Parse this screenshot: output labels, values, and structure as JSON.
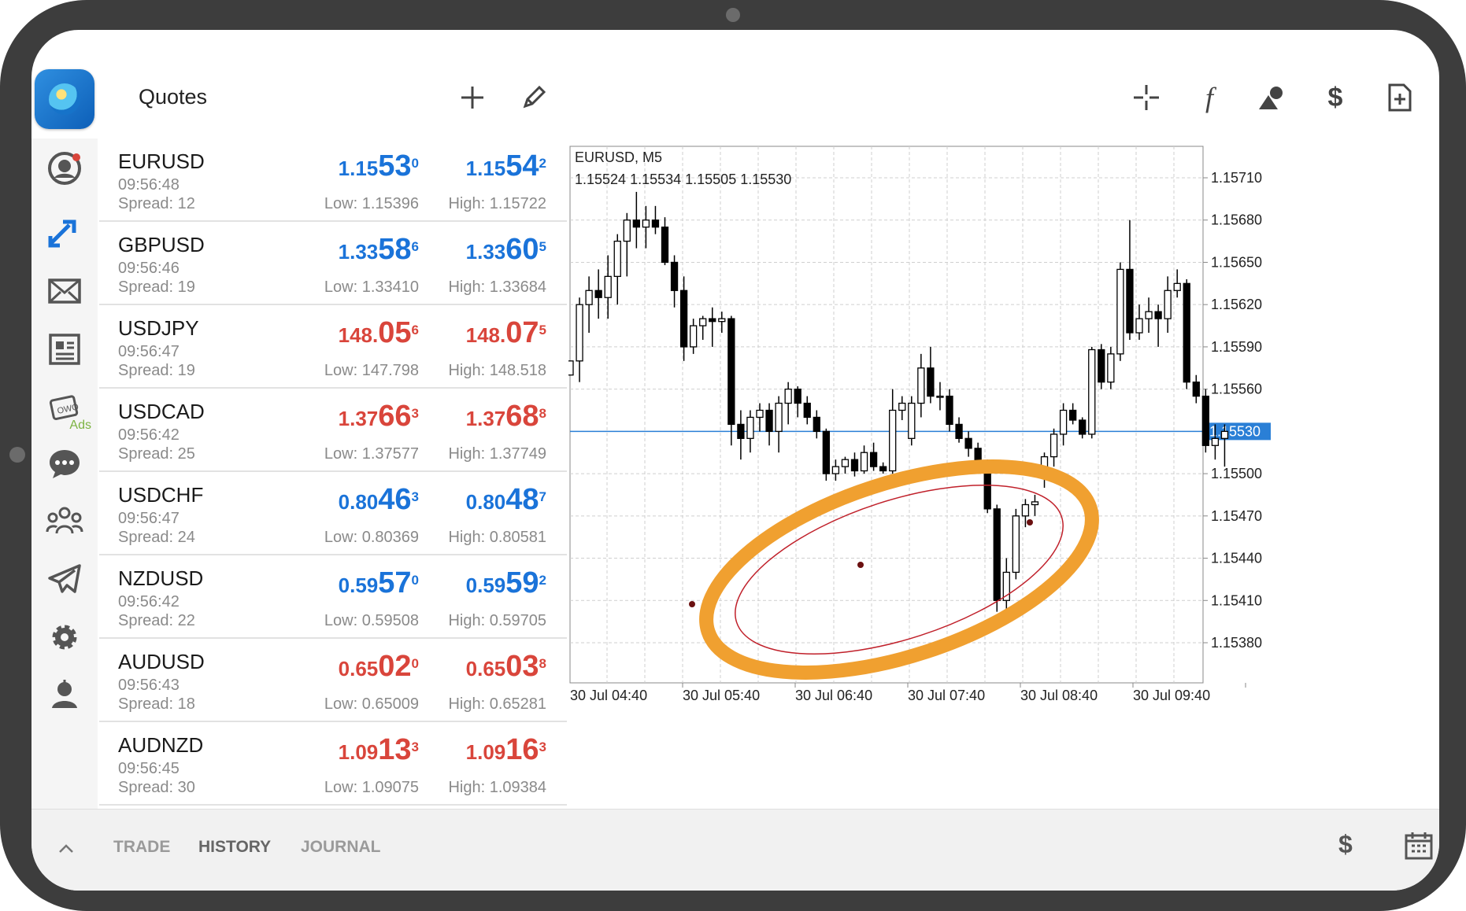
{
  "header": {
    "title": "Quotes"
  },
  "icons": {
    "add": "plus-icon",
    "edit": "pencil-icon",
    "crosshair": "crosshair-icon",
    "indicators": "function-icon",
    "objects": "shapes-icon",
    "trade": "dollar-trade-icon",
    "new": "new-document-icon"
  },
  "sidebar": {
    "ads_label": "Ads"
  },
  "quotes": [
    {
      "symbol": "EURUSD",
      "time": "09:56:48",
      "spread": "Spread: 12",
      "bid": {
        "pre": "1.15",
        "big": "53",
        "sup": "0"
      },
      "ask": {
        "pre": "1.15",
        "big": "54",
        "sup": "2"
      },
      "low": "Low: 1.15396",
      "high": "High: 1.15722",
      "color": "blue"
    },
    {
      "symbol": "GBPUSD",
      "time": "09:56:46",
      "spread": "Spread: 19",
      "bid": {
        "pre": "1.33",
        "big": "58",
        "sup": "6"
      },
      "ask": {
        "pre": "1.33",
        "big": "60",
        "sup": "5"
      },
      "low": "Low: 1.33410",
      "high": "High: 1.33684",
      "color": "blue"
    },
    {
      "symbol": "USDJPY",
      "time": "09:56:47",
      "spread": "Spread: 19",
      "bid": {
        "pre": "148.",
        "big": "05",
        "sup": "6"
      },
      "ask": {
        "pre": "148.",
        "big": "07",
        "sup": "5"
      },
      "low": "Low: 147.798",
      "high": "High: 148.518",
      "color": "red"
    },
    {
      "symbol": "USDCAD",
      "time": "09:56:42",
      "spread": "Spread: 25",
      "bid": {
        "pre": "1.37",
        "big": "66",
        "sup": "3"
      },
      "ask": {
        "pre": "1.37",
        "big": "68",
        "sup": "8"
      },
      "low": "Low: 1.37577",
      "high": "High: 1.37749",
      "color": "red"
    },
    {
      "symbol": "USDCHF",
      "time": "09:56:47",
      "spread": "Spread: 24",
      "bid": {
        "pre": "0.80",
        "big": "46",
        "sup": "3"
      },
      "ask": {
        "pre": "0.80",
        "big": "48",
        "sup": "7"
      },
      "low": "Low: 0.80369",
      "high": "High: 0.80581",
      "color": "blue"
    },
    {
      "symbol": "NZDUSD",
      "time": "09:56:42",
      "spread": "Spread: 22",
      "bid": {
        "pre": "0.59",
        "big": "57",
        "sup": "0"
      },
      "ask": {
        "pre": "0.59",
        "big": "59",
        "sup": "2"
      },
      "low": "Low: 0.59508",
      "high": "High: 0.59705",
      "color": "blue"
    },
    {
      "symbol": "AUDUSD",
      "time": "09:56:43",
      "spread": "Spread: 18",
      "bid": {
        "pre": "0.65",
        "big": "02",
        "sup": "0"
      },
      "ask": {
        "pre": "0.65",
        "big": "03",
        "sup": "8"
      },
      "low": "Low: 0.65009",
      "high": "High: 0.65281",
      "color": "red"
    },
    {
      "symbol": "AUDNZD",
      "time": "09:56:45",
      "spread": "Spread: 30",
      "bid": {
        "pre": "1.09",
        "big": "13",
        "sup": "3"
      },
      "ask": {
        "pre": "1.09",
        "big": "16",
        "sup": "3"
      },
      "low": "Low: 1.09075",
      "high": "High: 1.09384",
      "color": "red"
    }
  ],
  "chart": {
    "symbol_label": "EURUSD, M5",
    "ohlc_label": "1.15524 1.15534 1.15505 1.15530",
    "price_labels": [
      "1.15710",
      "1.15680",
      "1.15650",
      "1.15620",
      "1.15590",
      "1.15560",
      "1.15530",
      "1.15500",
      "1.15470",
      "1.15440",
      "1.15410",
      "1.15380"
    ],
    "current_price": "1.15530",
    "time_labels": [
      "30 Jul 04:40",
      "30 Jul 05:40",
      "30 Jul 06:40",
      "30 Jul 07:40",
      "30 Jul 08:40",
      "30 Jul 09:40"
    ],
    "highlight_color": "#f0a030",
    "ellipse_color": "#c0202a",
    "bid_line_color": "#2a7fd6"
  },
  "candles": [
    [
      1.1557,
      1.1558,
      1.1557,
      1.1558
    ],
    [
      1.1558,
      1.15625,
      1.15565,
      1.1562
    ],
    [
      1.1562,
      1.1564,
      1.156,
      1.1563
    ],
    [
      1.1563,
      1.15645,
      1.1561,
      1.15625
    ],
    [
      1.15625,
      1.15655,
      1.1561,
      1.1564
    ],
    [
      1.1564,
      1.1567,
      1.1562,
      1.15665
    ],
    [
      1.15665,
      1.15685,
      1.1564,
      1.1568
    ],
    [
      1.1568,
      1.157,
      1.1566,
      1.15675
    ],
    [
      1.15675,
      1.1569,
      1.1566,
      1.1568
    ],
    [
      1.1568,
      1.1569,
      1.1567,
      1.15675
    ],
    [
      1.15675,
      1.15682,
      1.15648,
      1.1565
    ],
    [
      1.1565,
      1.15655,
      1.15618,
      1.1563
    ],
    [
      1.1563,
      1.1564,
      1.1558,
      1.1559
    ],
    [
      1.1559,
      1.1561,
      1.15585,
      1.15605
    ],
    [
      1.15605,
      1.15612,
      1.15595,
      1.1561
    ],
    [
      1.1561,
      1.15618,
      1.1559,
      1.15608
    ],
    [
      1.15608,
      1.15615,
      1.156,
      1.1561
    ],
    [
      1.1561,
      1.15612,
      1.1552,
      1.15535
    ],
    [
      1.15535,
      1.15545,
      1.1551,
      1.15525
    ],
    [
      1.15525,
      1.15545,
      1.15515,
      1.1554
    ],
    [
      1.1554,
      1.1555,
      1.1553,
      1.15545
    ],
    [
      1.15545,
      1.1555,
      1.1552,
      1.1553
    ],
    [
      1.1553,
      1.15555,
      1.15515,
      1.1555
    ],
    [
      1.1555,
      1.15565,
      1.15535,
      1.1556
    ],
    [
      1.1556,
      1.15562,
      1.1554,
      1.1555
    ],
    [
      1.1555,
      1.15555,
      1.15535,
      1.1554
    ],
    [
      1.1554,
      1.15545,
      1.15525,
      1.1553
    ],
    [
      1.1553,
      1.15532,
      1.15495,
      1.155
    ],
    [
      1.155,
      1.1551,
      1.15495,
      1.15505
    ],
    [
      1.15505,
      1.15512,
      1.155,
      1.1551
    ],
    [
      1.1551,
      1.15515,
      1.15498,
      1.15502
    ],
    [
      1.15502,
      1.1552,
      1.155,
      1.15515
    ],
    [
      1.15515,
      1.15522,
      1.15502,
      1.15505
    ],
    [
      1.15505,
      1.15508,
      1.155,
      1.15502
    ],
    [
      1.15502,
      1.1556,
      1.155,
      1.15545
    ],
    [
      1.15545,
      1.15555,
      1.15538,
      1.1555
    ],
    [
      1.15525,
      1.15555,
      1.1552,
      1.1555
    ],
    [
      1.1555,
      1.15585,
      1.1554,
      1.15575
    ],
    [
      1.15575,
      1.1559,
      1.1555,
      1.15555
    ],
    [
      1.15555,
      1.15565,
      1.15545,
      1.15555
    ],
    [
      1.15555,
      1.1556,
      1.1553,
      1.15535
    ],
    [
      1.15535,
      1.1554,
      1.15522,
      1.15525
    ],
    [
      1.15525,
      1.1553,
      1.15512,
      1.15518
    ],
    [
      1.15518,
      1.15522,
      1.155,
      1.15508
    ],
    [
      1.15508,
      1.1551,
      1.15472,
      1.15475
    ],
    [
      1.15475,
      1.15478,
      1.15402,
      1.1541
    ],
    [
      1.1541,
      1.1544,
      1.154,
      1.1543
    ],
    [
      1.1543,
      1.15475,
      1.15425,
      1.1547
    ],
    [
      1.1547,
      1.15482,
      1.15462,
      1.15478
    ],
    [
      1.15478,
      1.15485,
      1.1547,
      1.1548
    ],
    [
      1.15498,
      1.15515,
      1.1549,
      1.15512
    ],
    [
      1.15512,
      1.15532,
      1.15505,
      1.15528
    ],
    [
      1.15528,
      1.1555,
      1.1552,
      1.15545
    ],
    [
      1.15545,
      1.1555,
      1.15535,
      1.15538
    ],
    [
      1.15538,
      1.1554,
      1.15525,
      1.15528
    ],
    [
      1.15528,
      1.1559,
      1.15525,
      1.15588
    ],
    [
      1.15588,
      1.15592,
      1.1556,
      1.15565
    ],
    [
      1.15565,
      1.1559,
      1.1556,
      1.15585
    ],
    [
      1.15585,
      1.1565,
      1.1558,
      1.15645
    ],
    [
      1.15645,
      1.1568,
      1.15595,
      1.156
    ],
    [
      1.156,
      1.1562,
      1.15595,
      1.1561
    ],
    [
      1.1561,
      1.15625,
      1.156,
      1.15615
    ],
    [
      1.15615,
      1.1562,
      1.1559,
      1.1561
    ],
    [
      1.1561,
      1.1564,
      1.156,
      1.1563
    ],
    [
      1.1563,
      1.15645,
      1.15625,
      1.15635
    ],
    [
      1.15635,
      1.15638,
      1.1556,
      1.15565
    ],
    [
      1.15565,
      1.1557,
      1.1555,
      1.15555
    ],
    [
      1.15555,
      1.1556,
      1.15515,
      1.1552
    ],
    [
      1.1552,
      1.15535,
      1.1551,
      1.15525
    ],
    [
      1.15525,
      1.15535,
      1.15505,
      1.1553
    ]
  ],
  "tabs": {
    "trade": "TRADE",
    "history": "HISTORY",
    "journal": "JOURNAL"
  }
}
